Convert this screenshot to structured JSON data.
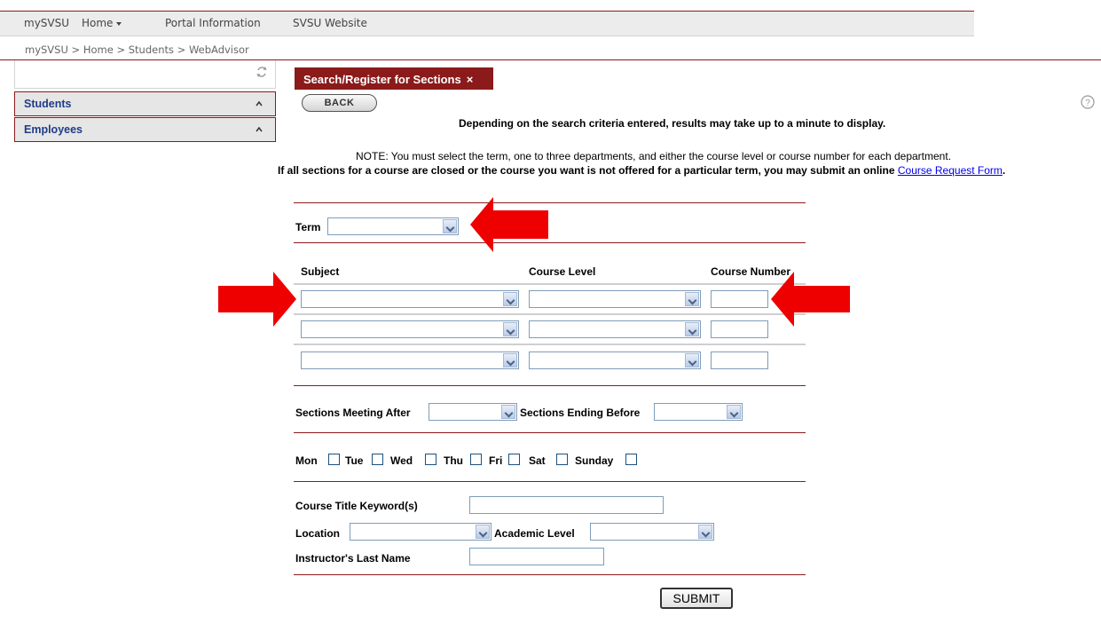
{
  "nav": {
    "items": [
      "mySVSU",
      "Home",
      "Portal Information",
      "SVSU Website"
    ]
  },
  "breadcrumb": "mySVSU > Home > Students > WebAdvisor",
  "sidebar": {
    "items": [
      {
        "label": "Students"
      },
      {
        "label": "Employees"
      }
    ]
  },
  "tab": {
    "title": "Search/Register for Sections",
    "close": "×"
  },
  "back_label": "BACK",
  "messages": {
    "wait": "Depending on the search criteria entered, results may take up to a minute to display.",
    "note": "NOTE: You must select the term, one to three departments, and either the course level or course number for each department.",
    "closed": "If all sections for a course are closed or the course you want is not offered for a particular term, you may submit an online",
    "link": "Course Request Form",
    "link_end": "."
  },
  "form": {
    "term_label": "Term",
    "subject_header": "Subject",
    "level_header": "Course Level",
    "number_header": "Course Number",
    "meeting_after_label": "Sections Meeting After",
    "ending_before_label": "Sections Ending Before",
    "days": [
      "Mon",
      "Tue",
      "Wed",
      "Thu",
      "Fri",
      "Sat",
      "Sunday"
    ],
    "keyword_label": "Course Title Keyword(s)",
    "location_label": "Location",
    "academic_level_label": "Academic Level",
    "instructor_label": "Instructor's Last Name",
    "submit_label": "SUBMIT"
  },
  "colors": {
    "brand": "#8b1a1a",
    "arrow": "#ee0000",
    "link": "#0000ee",
    "sidebar_text": "#1f3c88"
  },
  "icons": [
    "refresh-icon",
    "chevron-up-icon",
    "close-icon",
    "help-icon",
    "dropdown-arrow-icon",
    "red-arrow-annotation"
  ]
}
